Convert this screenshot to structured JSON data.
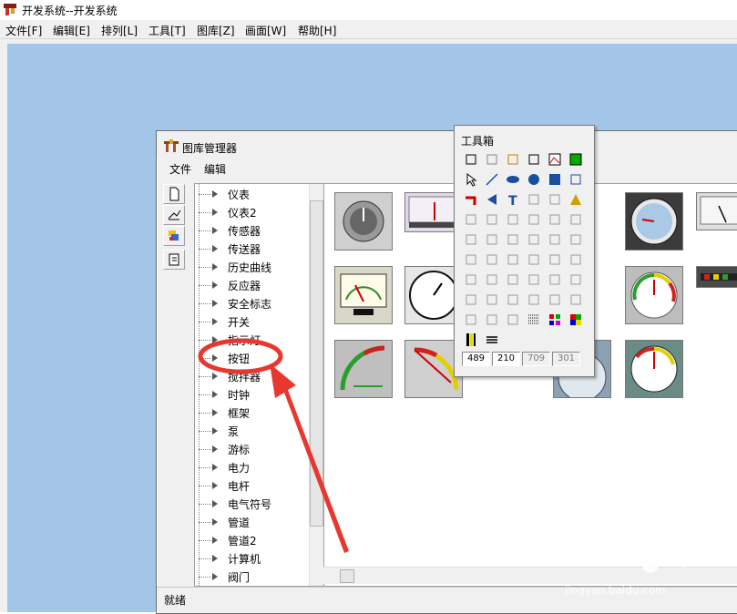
{
  "app": {
    "title": "开发系统--开发系统",
    "menu": [
      "文件[F]",
      "编辑[E]",
      "排列[L]",
      "工具[T]",
      "图库[Z]",
      "画面[W]",
      "帮助[H]"
    ]
  },
  "library_window": {
    "title": "图库管理器",
    "menu": [
      "文件",
      "编辑"
    ],
    "categories": [
      "仪表",
      "仪表2",
      "传感器",
      "传送器",
      "历史曲线",
      "反应器",
      "安全标志",
      "开关",
      "指示灯",
      "按钮",
      "搅拌器",
      "时钟",
      "框架",
      "泵",
      "游标",
      "电力",
      "电杆",
      "电气符号",
      "管道",
      "管道2",
      "计算机",
      "阀门"
    ],
    "status": "就绪"
  },
  "toolbox": {
    "title": "工具箱",
    "coords": [
      "489",
      "210",
      "709",
      "301"
    ]
  },
  "watermark": {
    "brand": "Bai du 经验",
    "url": "jingyan.baidu.com"
  },
  "colors": {
    "workspace": "#a3c5e8",
    "annotation": "#e8372f",
    "window": "#f0f0f0"
  }
}
